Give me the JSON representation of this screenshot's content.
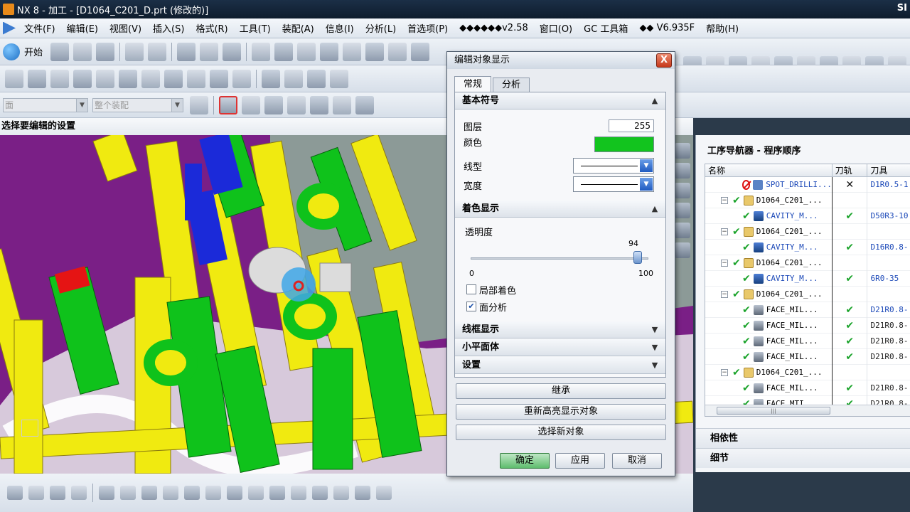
{
  "window": {
    "title": "NX 8 - 加工 - [D1064_C201_D.prt (修改的)]",
    "brand": "SI"
  },
  "menu": [
    "文件(F)",
    "编辑(E)",
    "视图(V)",
    "插入(S)",
    "格式(R)",
    "工具(T)",
    "装配(A)",
    "信息(I)",
    "分析(L)",
    "首选项(P)",
    "◆◆◆◆◆◆v2.58",
    "窗口(O)",
    "GC 工具箱",
    "◆◆ V6.935F",
    "帮助(H)"
  ],
  "toolbar": {
    "start_label": "开始"
  },
  "filters": {
    "type_filter": "面",
    "scope_filter": "整个装配"
  },
  "cue_line": "选择要编辑的设置",
  "dialog": {
    "title": "编辑对象显示",
    "close_label": "X",
    "tabs": [
      "常规",
      "分析"
    ],
    "basic_section": "基本符号",
    "layer_label": "图层",
    "layer_value": "255",
    "color_label": "颜色",
    "color_value": "#12c41e",
    "linetype_label": "线型",
    "width_label": "宽度",
    "shading_section": "着色显示",
    "transparency_label": "透明度",
    "transparency_value": "94",
    "transparency_fraction": 0.94,
    "slider_min": "0",
    "slider_max": "100",
    "partial_shading_label": "局部着色",
    "partial_shading_checked": false,
    "face_analysis_label": "面分析",
    "face_analysis_checked": true,
    "wireframe_section": "线框显示",
    "facet_section": "小平面体",
    "settings_section": "设置",
    "inherit_button": "继承",
    "rehighlight_button": "重新高亮显示对象",
    "select_new_button": "选择新对象",
    "ok_button": "确定",
    "apply_button": "应用",
    "cancel_button": "取消"
  },
  "navigator": {
    "title": "工序导航器 - 程序顺序",
    "columns": [
      "名称",
      "刀轨",
      "刀具"
    ],
    "rows": [
      {
        "name": "SPOT_DRILLI...",
        "kind": "spot",
        "path": "✕",
        "tool": "D1R0.5-1",
        "indent": 1,
        "status": "no"
      },
      {
        "name": "D1064_C201_...",
        "kind": "prog",
        "path": "",
        "tool": "",
        "indent": 0,
        "status": "ok"
      },
      {
        "name": "CAVITY_M...",
        "kind": "mill",
        "path": "✔",
        "tool": "D50R3-10",
        "indent": 1,
        "status": "ok"
      },
      {
        "name": "D1064_C201_...",
        "kind": "prog",
        "path": "",
        "tool": "",
        "indent": 0,
        "status": "ok"
      },
      {
        "name": "CAVITY_M...",
        "kind": "mill",
        "path": "✔",
        "tool": "D16R0.8-",
        "indent": 1,
        "status": "ok"
      },
      {
        "name": "D1064_C201_...",
        "kind": "prog",
        "path": "",
        "tool": "",
        "indent": 0,
        "status": "ok"
      },
      {
        "name": "CAVITY_M...",
        "kind": "mill",
        "path": "✔",
        "tool": "6R0-35",
        "indent": 1,
        "status": "ok"
      },
      {
        "name": "D1064_C201_...",
        "kind": "prog",
        "path": "",
        "tool": "",
        "indent": 0,
        "status": "ok"
      },
      {
        "name": "FACE_MIL...",
        "kind": "face",
        "path": "✔",
        "tool": "D21R0.8-",
        "indent": 1,
        "status": "ok"
      },
      {
        "name": "FACE_MIL...",
        "kind": "face",
        "path": "✔",
        "tool": "D21R0.8-",
        "indent": 1,
        "status": "ok"
      },
      {
        "name": "FACE_MIL...",
        "kind": "face",
        "path": "✔",
        "tool": "D21R0.8-",
        "indent": 1,
        "status": "ok"
      },
      {
        "name": "FACE_MIL...",
        "kind": "face",
        "path": "✔",
        "tool": "D21R0.8-",
        "indent": 1,
        "status": "ok"
      },
      {
        "name": "D1064_C201_...",
        "kind": "prog",
        "path": "",
        "tool": "",
        "indent": 0,
        "status": "ok"
      },
      {
        "name": "FACE_MIL...",
        "kind": "face",
        "path": "✔",
        "tool": "D21R0.8-",
        "indent": 1,
        "status": "ok"
      },
      {
        "name": "FACE_MTI",
        "kind": "face",
        "path": "✔",
        "tool": "D21R0.8-",
        "indent": 1,
        "status": "ok"
      }
    ],
    "dependencies_label": "相依性",
    "details_label": "细节"
  },
  "colors": {
    "yellow": "#f0ea10",
    "green": "#0fc21b",
    "purple": "#7a1f86",
    "blue": "#1b2ad9",
    "accent_ok": "#1aa32a"
  }
}
